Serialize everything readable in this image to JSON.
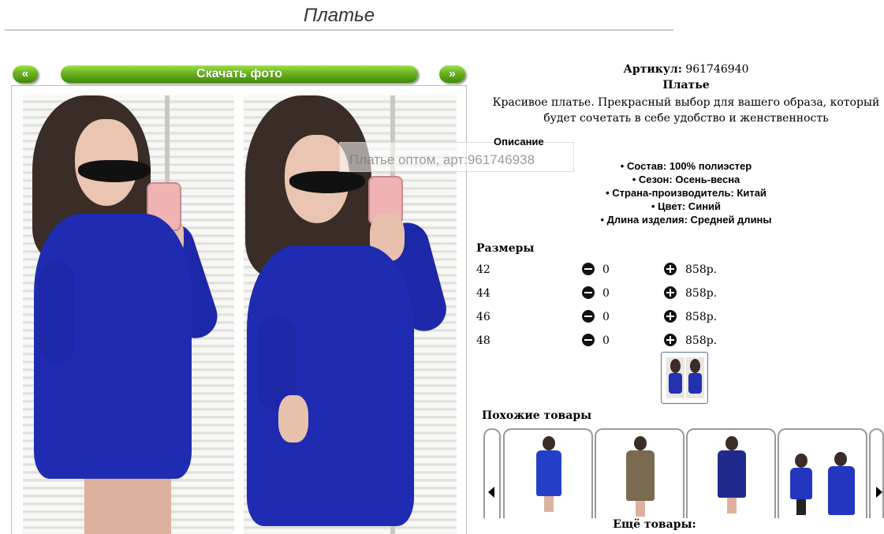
{
  "page": {
    "title": "Платье"
  },
  "gallery": {
    "prev_label": "«",
    "download_label": "Скачать фото",
    "next_label": "»",
    "watermark": "Платье оптом, арт:961746938"
  },
  "product": {
    "article_label": "Артикул:",
    "article_value": "961746940",
    "name": "Платье",
    "description": "Красивое платье. Прекрасный выбор для вашего образа, который будет сочетать в себе удобство и женственность"
  },
  "specs": {
    "heading": "Описание",
    "items": [
      "Состав: 100% полиэстер",
      "Сезон: Осень-весна",
      "Страна-производитель: Китай",
      "Цвет: Синий",
      "Длина изделия: Средней длины"
    ]
  },
  "sizes": {
    "heading": "Размеры",
    "rows": [
      {
        "size": "42",
        "qty": "0",
        "price": "858р."
      },
      {
        "size": "44",
        "qty": "0",
        "price": "858р."
      },
      {
        "size": "46",
        "qty": "0",
        "price": "858р."
      },
      {
        "size": "48",
        "qty": "0",
        "price": "858р."
      }
    ]
  },
  "similar": {
    "heading": "Похожие товары",
    "more_heading": "Ещё товары:"
  },
  "colors": {
    "accent_green": "#6cb21f",
    "dress_blue": "#1f2bb0"
  }
}
